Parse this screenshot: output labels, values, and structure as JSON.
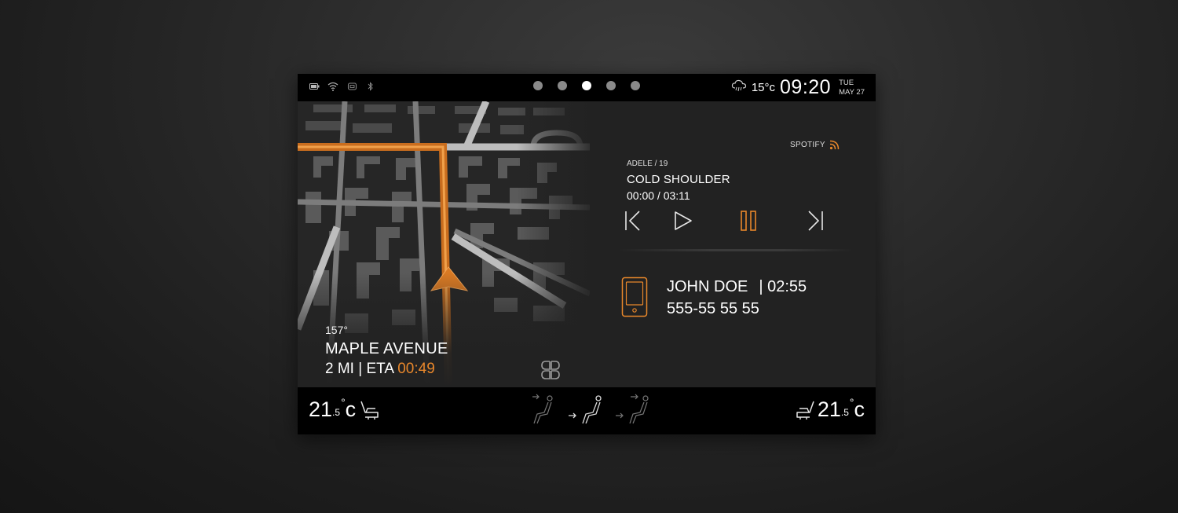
{
  "status_bar": {
    "icons": [
      "battery-icon",
      "wifi-icon",
      "screen-mirror-icon",
      "bluetooth-icon"
    ],
    "page_dots": {
      "count": 5,
      "active_index": 2
    },
    "weather": {
      "icon": "cloud-rain-icon",
      "temperature": "15°c"
    },
    "time": "09:20",
    "day": "TUE",
    "date": "MAY 27"
  },
  "navigation": {
    "heading": "157°",
    "street": "MAPLE AVENUE",
    "distance": "2 MI | ETA ",
    "eta": "00:49",
    "route_color": "#e8872b"
  },
  "media": {
    "source": "SPOTIFY",
    "source_icon": "rss-feed-icon",
    "artist_album": "ADELE / 19",
    "track": "COLD SHOULDER",
    "time": "00:00 / 03:11",
    "controls": [
      "previous-icon",
      "play-icon",
      "pause-icon",
      "next-icon"
    ],
    "active_control": "pause-icon"
  },
  "call": {
    "icon": "phone-icon",
    "caller": "JOHN DOE",
    "duration": "| 02:55",
    "number": "555-55 55 55"
  },
  "climate": {
    "left": {
      "whole": "21",
      "fraction": ".5",
      "degree": "°",
      "unit": "c"
    },
    "right": {
      "whole": "21",
      "fraction": ".5",
      "degree": "°",
      "unit": "c"
    },
    "air_modes": [
      "face-airflow-icon",
      "face-feet-airflow-icon",
      "feet-airflow-icon"
    ]
  },
  "accent_color": "#e8872b"
}
